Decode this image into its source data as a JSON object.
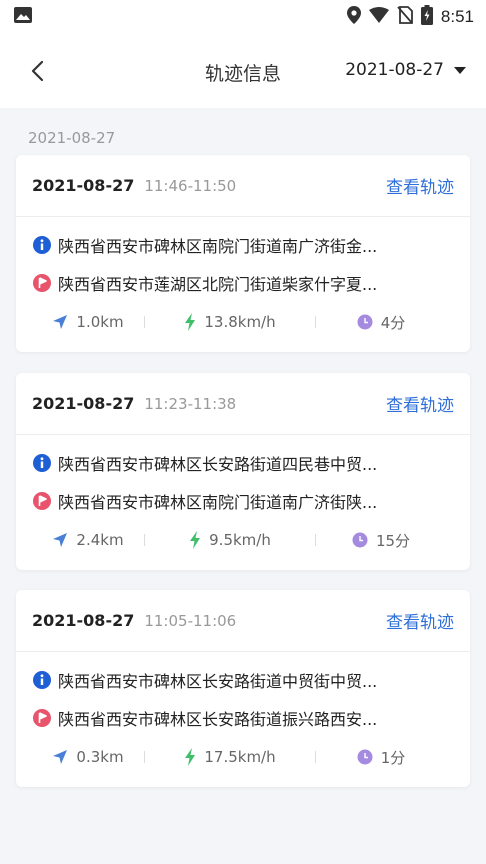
{
  "status": {
    "time": "8:51"
  },
  "header": {
    "title": "轨迹信息",
    "date_filter": "2021-08-27"
  },
  "section_date": "2021-08-27",
  "view_label": "查看轨迹",
  "trips": [
    {
      "date": "2021-08-27",
      "time_range": "11:46-11:50",
      "start": "陕西省西安市碑林区南院门街道南广济街金...",
      "end": "陕西省西安市莲湖区北院门街道柴家什字夏...",
      "distance": "1.0km",
      "speed": "13.8km/h",
      "duration": "4分"
    },
    {
      "date": "2021-08-27",
      "time_range": "11:23-11:38",
      "start": "陕西省西安市碑林区长安路街道四民巷中贸...",
      "end": "陕西省西安市碑林区南院门街道南广济街陕...",
      "distance": "2.4km",
      "speed": "9.5km/h",
      "duration": "15分"
    },
    {
      "date": "2021-08-27",
      "time_range": "11:05-11:06",
      "start": "陕西省西安市碑林区长安路街道中贸街中贸...",
      "end": "陕西省西安市碑林区长安路街道振兴路西安...",
      "distance": "0.3km",
      "speed": "17.5km/h",
      "duration": "1分"
    }
  ],
  "colors": {
    "link": "#2f6fd8",
    "start_icon": "#1f5fd6",
    "end_icon": "#e8546b",
    "distance_icon": "#4a7fd6",
    "speed_icon": "#3fbf6a",
    "duration_icon": "#a58be0"
  }
}
